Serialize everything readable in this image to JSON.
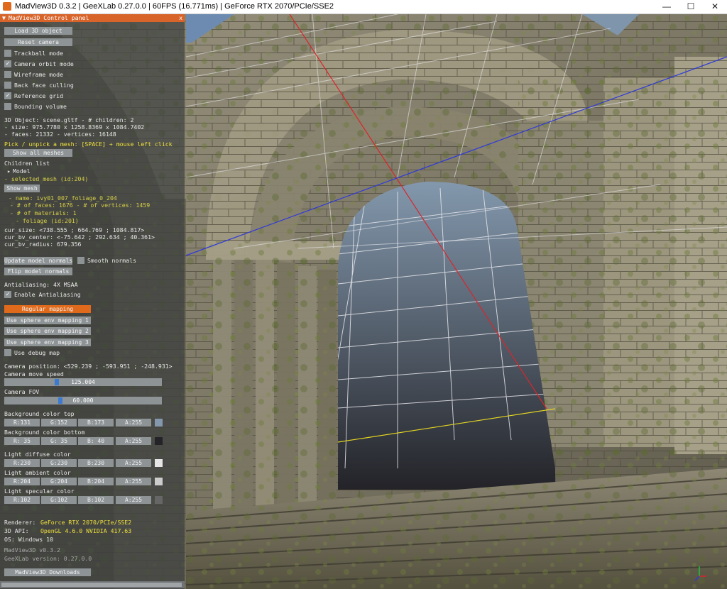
{
  "window": {
    "title": "MadView3D 0.3.2 | GeeXLab 0.27.0.0 | 60FPS (16.771ms) | GeForce RTX 2070/PCIe/SSE2",
    "min_glyph": "—",
    "max_glyph": "☐",
    "close_glyph": "✕"
  },
  "panel": {
    "title": "MadView3D Control panel",
    "collapse_glyph": "▼",
    "close_glyph": "x",
    "load_button": "Load 3D object",
    "reset_button": "Reset camera",
    "options": [
      {
        "label": "Trackball mode",
        "checked": false
      },
      {
        "label": "Camera orbit mode",
        "checked": true
      },
      {
        "label": "Wireframe mode",
        "checked": false
      },
      {
        "label": "Back face culling",
        "checked": false
      },
      {
        "label": "Reference grid",
        "checked": true
      },
      {
        "label": "Bounding volume",
        "checked": false
      }
    ],
    "object_info": [
      "3D Object: scene.gltf - # children: 2",
      "- size:  975.7780 x 1258.8369 x 1084.7402",
      "- faces: 21332 - vertices: 16148"
    ],
    "pick_hint": "Pick / unpick a mesh: [SPACE] + mouse left click",
    "show_all_meshes": "Show all meshes",
    "children_list_label": "Children list",
    "tree_model": "Model",
    "selected_mesh": "- selected mesh (id:204)",
    "show_mesh": "Show mesh",
    "mesh_details": [
      "- name: ivy01_007_foliage_0_204",
      "- # of faces: 1676 - # of vertices: 1459",
      "- # of materials: 1",
      "- foliage (id:201)"
    ],
    "cur_info": [
      "cur_size: <738.555 ; 664.769 ; 1084.817>",
      "cur_bv_center: <-75.642 ; 292.634 ; 40.361>",
      "cur_bv_radius: 679.356"
    ],
    "update_normals": "Update model normals",
    "smooth_normals": "Smooth normals",
    "flip_normals": "Flip model normals",
    "antialiasing_label": "Antialiasing: 4X MSAA",
    "enable_aa": "Enable Antialiasing",
    "mapping_buttons": [
      "Regular mapping",
      "Use sphere env mapping 1",
      "Use sphere env mapping 2",
      "Use sphere env mapping 3"
    ],
    "debug_map": "Use debug map",
    "camera_position": "Camera position: <529.239 ; -593.951 ; -248.931>",
    "camera_move_speed_label": "Camera move speed",
    "camera_move_speed_value": "125.004",
    "camera_move_speed_fraction": 0.33,
    "camera_fov_label": "Camera FOV",
    "camera_fov_value": "60.000",
    "camera_fov_fraction": 0.35,
    "colors": [
      {
        "label": "Background color top",
        "r": "R:131",
        "g": "G:152",
        "b": "B:173",
        "a": "A:255",
        "hex": "#8398ad"
      },
      {
        "label": "Background color bottom",
        "r": "R: 35",
        "g": "G: 35",
        "b": "B: 40",
        "a": "A:255",
        "hex": "#232328"
      },
      {
        "label": "Light diffuse color",
        "r": "R:230",
        "g": "G:230",
        "b": "B:230",
        "a": "A:255",
        "hex": "#e6e6e6"
      },
      {
        "label": "Light ambient color",
        "r": "R:204",
        "g": "G:204",
        "b": "B:204",
        "a": "A:255",
        "hex": "#cccccc"
      },
      {
        "label": "Light specular color",
        "r": "R:102",
        "g": "G:102",
        "b": "B:102",
        "a": "A:255",
        "hex": "#666666"
      }
    ],
    "renderer_label": "Renderer:",
    "renderer_value": "GeForce RTX 2070/PCIe/SSE2",
    "api_label": "3D API:",
    "api_value": "OpenGL 4.6.0 NVIDIA 417.63",
    "os_label": "OS: Windows 10",
    "app_version": "MadView3D v0.3.2",
    "geexlab_version": "GeeXLab version: 0.27.0.0",
    "downloads_button": "MadView3D Downloads"
  },
  "theme": {
    "accent": "#e06a1b",
    "button": "#8e9396",
    "highlight_text": "#f0e03c"
  }
}
